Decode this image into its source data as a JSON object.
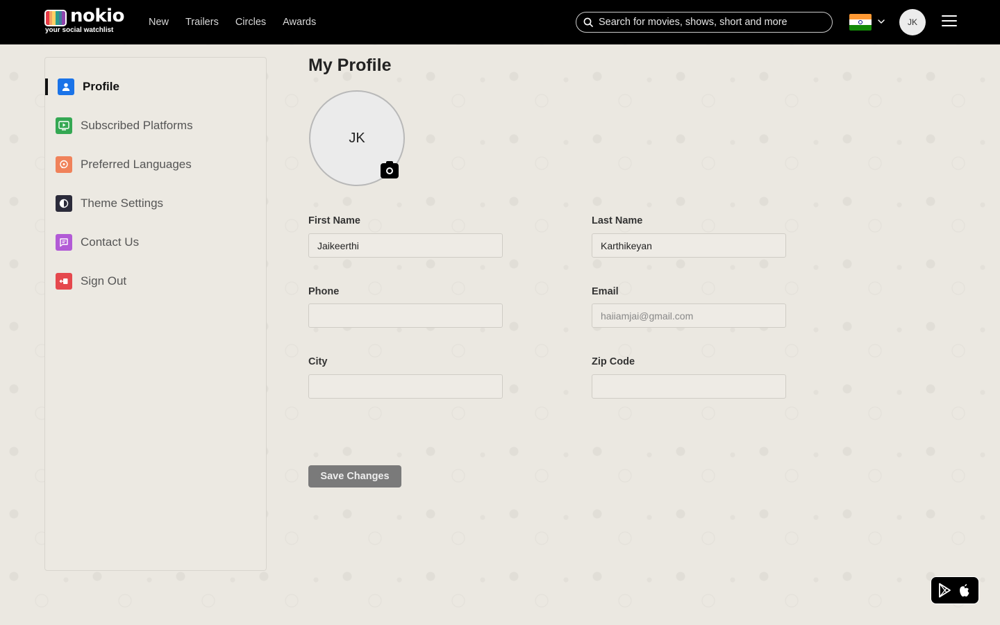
{
  "header": {
    "logo_text": "nokio",
    "logo_tagline": "your social watchlist",
    "nav": [
      "New",
      "Trailers",
      "Circles",
      "Awards"
    ],
    "search_placeholder": "Search for movies, shows, short and more",
    "avatar_initials": "JK"
  },
  "sidebar": {
    "items": [
      {
        "label": "Profile",
        "icon": "person-icon",
        "color": "#1a73e8"
      },
      {
        "label": "Subscribed Platforms",
        "icon": "play-screen-icon",
        "color": "#34a853"
      },
      {
        "label": "Preferred Languages",
        "icon": "language-icon",
        "color": "#f0825a"
      },
      {
        "label": "Theme Settings",
        "icon": "theme-icon",
        "color": "#2b2b3a"
      },
      {
        "label": "Contact Us",
        "icon": "chat-icon",
        "color": "#b25ad6"
      },
      {
        "label": "Sign Out",
        "icon": "sign-out-icon",
        "color": "#e5484d"
      }
    ]
  },
  "main": {
    "title": "My Profile",
    "avatar_initials": "JK",
    "fields": {
      "first_name": {
        "label": "First Name",
        "value": "Jaikeerthi"
      },
      "last_name": {
        "label": "Last Name",
        "value": "Karthikeyan"
      },
      "phone": {
        "label": "Phone",
        "value": ""
      },
      "email": {
        "label": "Email",
        "placeholder": "haiiamjai@gmail.com"
      },
      "city": {
        "label": "City",
        "value": ""
      },
      "zip": {
        "label": "Zip Code",
        "value": ""
      }
    },
    "save_label": "Save Changes"
  },
  "colors": {
    "header_bg": "#000000",
    "page_bg": "#ebe8e1",
    "save_button": "#7a7a7a"
  }
}
